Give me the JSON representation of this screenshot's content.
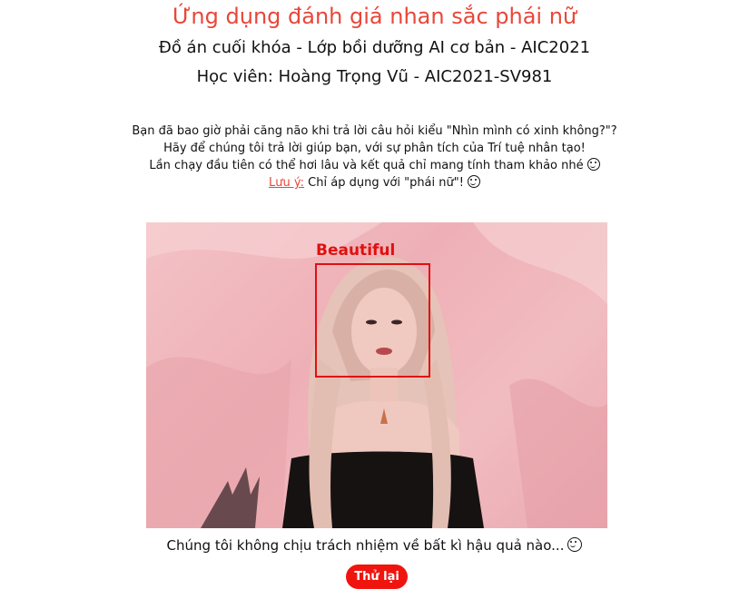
{
  "header": {
    "title": "Ứng dụng đánh giá nhan sắc phái nữ",
    "subtitle_project": "Đồ án cuối khóa - Lớp bồi dưỡng AI cơ bản - AIC2021",
    "subtitle_student": "Học viên: Hoàng Trọng Vũ - AIC2021-SV981"
  },
  "intro": {
    "line1": "Bạn đã bao giờ phải căng não khi trả lời câu hỏi kiểu \"Nhìn mình có xinh không?\"?",
    "line2": "Hãy để chúng tôi trả lời giúp bạn, với sự phân tích của Trí tuệ nhân tạo!",
    "line3": "Lần chạy đầu tiên có thể hơi lâu và kết quả chỉ mang tính tham khảo nhé",
    "note_label": "Lưu ý:",
    "note_text": "Chỉ áp dụng với \"phái nữ\"!"
  },
  "result": {
    "face_label": "Beautiful",
    "icons": [
      "wink-emoji-icon",
      "grin-emoji-icon",
      "laughing-emoji-icon"
    ]
  },
  "footer": {
    "disclaimer": "Chúng tôi không chịu trách nhiệm về bất kì hậu quả nào...",
    "retry_button": "Thử lại"
  },
  "colors": {
    "accent": "#e8473a",
    "button": "#f0140f",
    "face_box": "#e01010"
  }
}
